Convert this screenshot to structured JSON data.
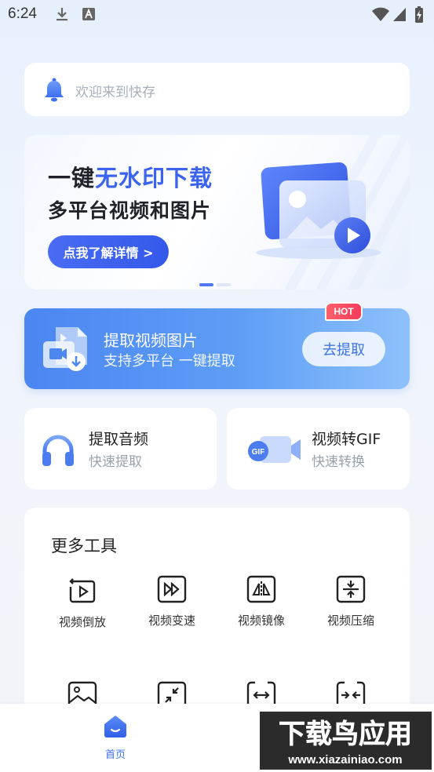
{
  "status_bar": {
    "time": "6:24"
  },
  "search": {
    "placeholder": "欢迎来到快存"
  },
  "banner": {
    "line1_prefix": "一键",
    "line1_highlight": "无水印下载",
    "line2": "多平台视频和图片",
    "button_label": "点我了解详情 >",
    "slide_index": 1,
    "slide_count": 2
  },
  "extract_card": {
    "badge": "HOT",
    "title": "提取视频图片",
    "subtitle": "支持多平台 一键提取",
    "button_label": "去提取"
  },
  "quick_tools": [
    {
      "title": "提取音频",
      "subtitle": "快速提取",
      "icon": "headphones-icon"
    },
    {
      "title": "视频转GIF",
      "subtitle": "快速转换",
      "icon": "gif-camera-icon"
    }
  ],
  "more_tools": {
    "title": "更多工具",
    "items": [
      {
        "label": "视频倒放",
        "icon": "reverse-play-icon"
      },
      {
        "label": "视频变速",
        "icon": "fast-forward-icon"
      },
      {
        "label": "视频镜像",
        "icon": "mirror-icon"
      },
      {
        "label": "视频压缩",
        "icon": "compress-icon"
      },
      {
        "label": "",
        "icon": "image-icon"
      },
      {
        "label": "",
        "icon": "shrink-icon"
      },
      {
        "label": "",
        "icon": "expand-horizontal-icon"
      },
      {
        "label": "",
        "icon": "merge-horizontal-icon"
      }
    ]
  },
  "bottom_nav": {
    "home_label": "首页"
  },
  "watermark": {
    "title": "下载鸟应用",
    "url": "www.xiazainiao.com"
  },
  "colors": {
    "accent": "#3c6ff0",
    "hot": "#f23c5c",
    "card_blue": "#4b86f1"
  }
}
